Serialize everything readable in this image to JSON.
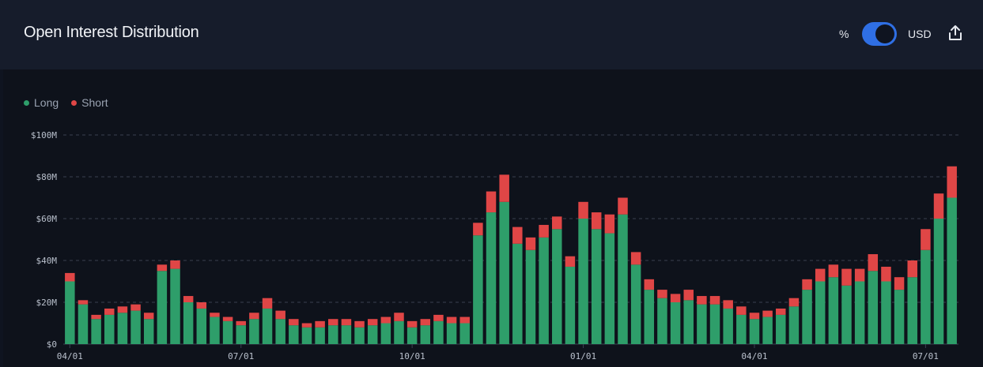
{
  "header": {
    "title": "Open Interest Distribution",
    "toggle_left_label": "%",
    "toggle_right_label": "USD",
    "toggle_state": "USD",
    "export_icon": "share-upload-icon"
  },
  "colors": {
    "long": "#2e9e6a",
    "short": "#e04646",
    "accent": "#2f6fe4"
  },
  "chart_data": {
    "type": "bar",
    "stacked": true,
    "legend": [
      "Long",
      "Short"
    ],
    "legend_position": "top-left",
    "grid": true,
    "ylim": [
      0,
      100
    ],
    "y_unit": "$M",
    "y_ticks": [
      "$0",
      "$20M",
      "$40M",
      "$60M",
      "$80M",
      "$100M"
    ],
    "x_ticks": [
      "04/01",
      "07/01",
      "10/01",
      "01/01",
      "04/01",
      "07/01"
    ],
    "x_tick_categories": [
      "04/01",
      "07/01",
      "10/01",
      "01/01",
      "04/01",
      "07/01"
    ],
    "categories": [
      "04/01",
      "04/08",
      "04/15",
      "04/22",
      "04/29",
      "05/06",
      "05/13",
      "05/20",
      "05/27",
      "06/03",
      "06/10",
      "06/17",
      "06/24",
      "07/01",
      "07/08",
      "07/15",
      "07/22",
      "07/29",
      "08/05",
      "08/12",
      "08/19",
      "08/26",
      "09/02",
      "09/09",
      "09/16",
      "09/23",
      "10/01",
      "10/08",
      "10/15",
      "10/22",
      "10/29",
      "11/05",
      "11/12",
      "11/19",
      "11/26",
      "12/03",
      "12/10",
      "12/17",
      "12/24",
      "01/01",
      "01/08",
      "01/15",
      "01/22",
      "01/29",
      "02/05",
      "02/12",
      "02/19",
      "02/26",
      "03/05",
      "03/12",
      "03/19",
      "03/26",
      "04/01",
      "04/08",
      "04/15",
      "04/22",
      "04/29",
      "05/06",
      "05/13",
      "05/20",
      "05/27",
      "06/03",
      "06/10",
      "06/17",
      "06/24",
      "07/01",
      "07/08",
      "07/15"
    ],
    "series": [
      {
        "name": "Long",
        "values": [
          30,
          19,
          12,
          14,
          15,
          16,
          12,
          35,
          36,
          20,
          17,
          13,
          11,
          9,
          12,
          17,
          12,
          9,
          8,
          8,
          9,
          9,
          8,
          9,
          10,
          11,
          8,
          9,
          11,
          10,
          10,
          52,
          63,
          68,
          48,
          45,
          51,
          55,
          37,
          60,
          55,
          53,
          62,
          38,
          26,
          22,
          20,
          21,
          19,
          19,
          17,
          14,
          12,
          13,
          14,
          18,
          26,
          30,
          32,
          28,
          30,
          35,
          30,
          26,
          32,
          45,
          60,
          70
        ]
      },
      {
        "name": "Short",
        "values": [
          4,
          2,
          2,
          3,
          3,
          3,
          3,
          3,
          4,
          3,
          3,
          2,
          2,
          2,
          3,
          5,
          4,
          3,
          2,
          3,
          3,
          3,
          3,
          3,
          3,
          4,
          3,
          3,
          3,
          3,
          3,
          6,
          10,
          13,
          8,
          6,
          6,
          6,
          5,
          8,
          8,
          9,
          8,
          6,
          5,
          4,
          4,
          5,
          4,
          4,
          4,
          4,
          3,
          3,
          3,
          4,
          5,
          6,
          6,
          8,
          6,
          8,
          7,
          6,
          8,
          10,
          12,
          15
        ]
      }
    ]
  }
}
